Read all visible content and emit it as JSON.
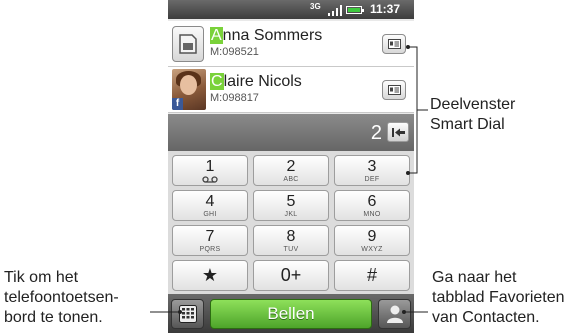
{
  "status_bar": {
    "network": "3G",
    "time": "11:37"
  },
  "contacts": [
    {
      "name_highlight": "A",
      "name_rest": "nna Sommers",
      "number": "M:098521"
    },
    {
      "name_highlight": "C",
      "name_rest": "laire Nicols",
      "number": "M:098817"
    }
  ],
  "number_display": {
    "digits": "2"
  },
  "keypad": [
    {
      "digit": "1",
      "letters": ""
    },
    {
      "digit": "2",
      "letters": "ABC"
    },
    {
      "digit": "3",
      "letters": "DEF"
    },
    {
      "digit": "4",
      "letters": "GHI"
    },
    {
      "digit": "5",
      "letters": "JKL"
    },
    {
      "digit": "6",
      "letters": "MNO"
    },
    {
      "digit": "7",
      "letters": "PQRS"
    },
    {
      "digit": "8",
      "letters": "TUV"
    },
    {
      "digit": "9",
      "letters": "WXYZ"
    },
    {
      "digit": "★",
      "letters": ""
    },
    {
      "digit": "0+",
      "letters": ""
    },
    {
      "digit": "#",
      "letters": ""
    }
  ],
  "bottom_bar": {
    "call_label": "Bellen"
  },
  "callouts": {
    "smartdial": [
      "Deelvenster",
      "Smart Dial"
    ],
    "keyboard": [
      "Tik om het",
      "telefoontoetsen-",
      "bord te tonen."
    ],
    "favorites": [
      "Ga naar het",
      "tabblad Favorieten",
      "van Contacten."
    ]
  },
  "colors": {
    "highlight": "#7ad23a",
    "call_button": "#5cb52f"
  },
  "icons": [
    "sim-card-icon",
    "contact-card-icon",
    "facebook-icon",
    "backspace-icon",
    "voicemail-icon",
    "keyboard-icon",
    "contacts-icon"
  ]
}
